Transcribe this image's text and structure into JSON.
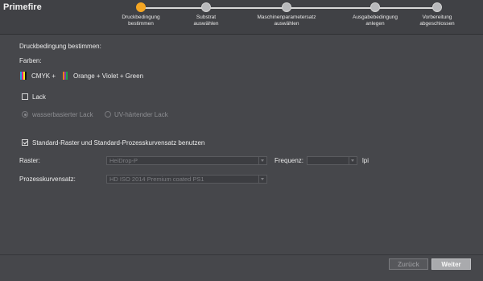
{
  "app": {
    "title": "Primefire"
  },
  "steps": [
    {
      "label": "Druckbedingung\nbestimmen",
      "active": true
    },
    {
      "label": "Substrat\nauswählen",
      "active": false
    },
    {
      "label": "Maschinenparametersatz\nauswählen",
      "active": false
    },
    {
      "label": "Ausgabebedingung\nanlegen",
      "active": false
    },
    {
      "label": "Vorbereitung\nabgeschlossen",
      "active": false
    }
  ],
  "form": {
    "heading": "Druckbedingung bestimmen:",
    "colors_label": "Farben:",
    "cmyk_label": "CMYK +",
    "extra_colors_label": "Orange + Violet + Green",
    "cmyk_colors": [
      "#1fa3e0",
      "#e0208a",
      "#f5e614",
      "#111111"
    ],
    "extra_colors": [
      "#f07d1a",
      "#7a3aa0",
      "#1aa84a"
    ],
    "lack_label": "Lack",
    "lack_checked": false,
    "lack_water_label": "wasserbasierter Lack",
    "lack_uv_label": "UV-härtender Lack",
    "standard_label": "Standard-Raster und Standard-Prozesskurvensatz benutzen",
    "standard_checked": true,
    "raster_label": "Raster:",
    "raster_value": "HeiDrop-P",
    "frequenz_label": "Frequenz:",
    "frequenz_value": "",
    "frequenz_unit": "lpi",
    "prozess_label": "Prozesskurvensatz:",
    "prozess_value": "HD ISO 2014 Premium coated PS1"
  },
  "footer": {
    "back_label": "Zurück",
    "next_label": "Weiter"
  }
}
